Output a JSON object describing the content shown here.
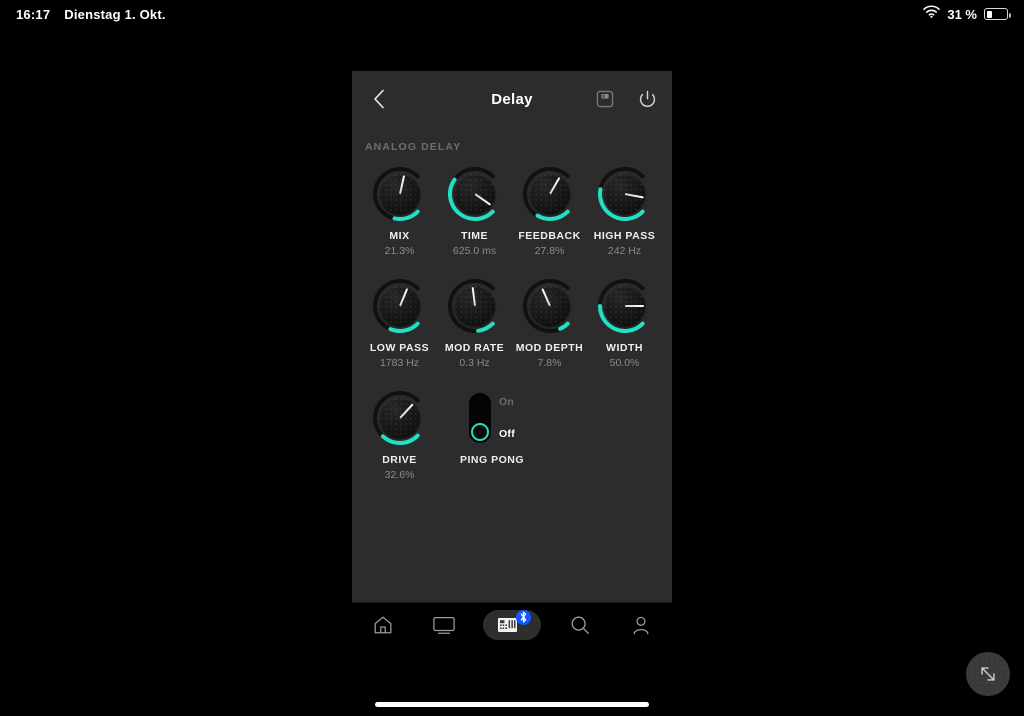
{
  "status_bar": {
    "time": "16:17",
    "date": "Dienstag 1. Okt.",
    "battery_text": "31 %",
    "battery_percent": 31,
    "wifi_icon": "wifi-icon",
    "battery_icon": "battery-icon"
  },
  "header": {
    "title": "Delay",
    "back_icon": "chevron-left-icon",
    "save_icon": "save-floppy-icon",
    "power_icon": "power-icon"
  },
  "section": {
    "label": "ANALOG DELAY"
  },
  "colors": {
    "accent": "#23e0c4",
    "panel_bg": "#2c2c2c",
    "screen_bg": "#000000",
    "label": "#efefef",
    "value": "#8c8c8c",
    "bluetooth_badge": "#1358ff"
  },
  "knob_rows": [
    [
      {
        "name": "MIX",
        "value": "21.3%",
        "fraction": 0.213
      },
      {
        "name": "TIME",
        "value": "625.0 ms",
        "fraction": 0.63
      },
      {
        "name": "FEEDBACK",
        "value": "27.8%",
        "fraction": 0.278
      },
      {
        "name": "HIGH PASS",
        "value": "242 Hz",
        "fraction": 0.54
      }
    ],
    [
      {
        "name": "LOW PASS",
        "value": "1783 Hz",
        "fraction": 0.25
      },
      {
        "name": "MOD RATE",
        "value": "0.3 Hz",
        "fraction": 0.14
      },
      {
        "name": "MOD DEPTH",
        "value": "7.8%",
        "fraction": 0.078
      },
      {
        "name": "WIDTH",
        "value": "50.0%",
        "fraction": 0.5
      }
    ]
  ],
  "last_row": {
    "drive": {
      "name": "DRIVE",
      "value": "32.6%",
      "fraction": 0.326
    },
    "toggle": {
      "name": "PING PONG",
      "on_label": "On",
      "off_label": "Off",
      "state": "Off"
    }
  },
  "tab_bar": {
    "tabs": [
      {
        "name": "home-tab",
        "icon": "home-icon",
        "active": false
      },
      {
        "name": "display-tab",
        "icon": "monitor-icon",
        "active": false
      },
      {
        "name": "devices-tab",
        "icon": "mixer-device-icon",
        "badge": "bluetooth-icon",
        "active": true
      },
      {
        "name": "search-tab",
        "icon": "search-icon",
        "active": false
      },
      {
        "name": "account-tab",
        "icon": "person-icon",
        "active": false
      }
    ]
  },
  "floating_button": {
    "icon": "resize-diagonal-icon"
  }
}
